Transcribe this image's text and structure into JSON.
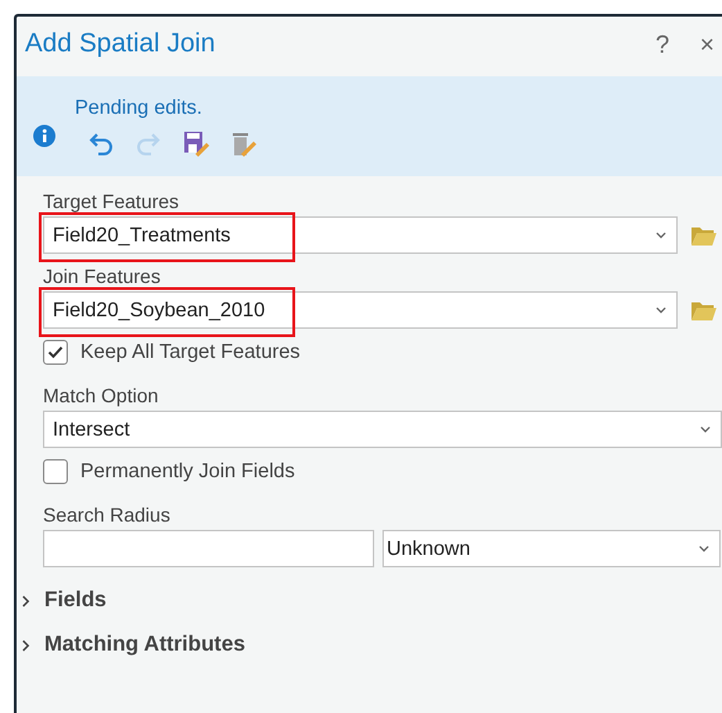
{
  "window": {
    "title": "Add Spatial Join",
    "help": "?",
    "close": "×"
  },
  "notice": {
    "text": "Pending edits.",
    "tools": [
      {
        "kind": "undo",
        "disabled": false
      },
      {
        "kind": "redo",
        "disabled": true
      },
      {
        "kind": "save-edits",
        "disabled": false
      },
      {
        "kind": "discard-edits",
        "disabled": false
      }
    ]
  },
  "parameters": [
    {
      "kind": "layer",
      "label": "Target Features",
      "value": "Field20_Treatments",
      "highlighted": true
    },
    {
      "kind": "layer",
      "label": "Join Features",
      "value": "Field20_Soybean_2010",
      "highlighted": true
    },
    {
      "kind": "checkbox",
      "label": "Keep All Target Features",
      "checked": true
    },
    {
      "kind": "dropdown",
      "label": "Match Option",
      "value": "Intersect"
    },
    {
      "kind": "checkbox",
      "label": "Permanently Join Fields",
      "checked": false
    },
    {
      "kind": "distance",
      "label": "Search Radius",
      "unit": "Unknown"
    }
  ],
  "sections": [
    {
      "label": "Fields",
      "expanded": false
    },
    {
      "label": "Matching Attributes",
      "expanded": false
    }
  ]
}
